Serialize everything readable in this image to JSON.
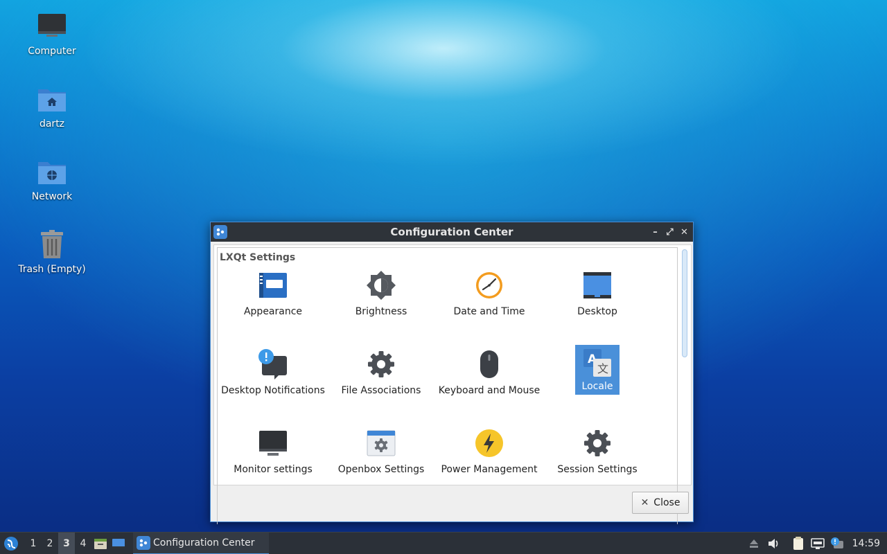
{
  "desktop": {
    "icons": [
      {
        "label": "Computer",
        "icon": "computer-icon"
      },
      {
        "label": "dartz",
        "icon": "home-folder-icon"
      },
      {
        "label": "Network",
        "icon": "network-folder-icon"
      },
      {
        "label": "Trash (Empty)",
        "icon": "trash-icon"
      }
    ]
  },
  "window": {
    "title": "Configuration Center",
    "controls": {
      "minimize": "–",
      "maximize": "⤢",
      "close": "✕"
    },
    "group_title": "LXQt Settings",
    "items": [
      {
        "label": "Appearance",
        "icon": "appearance-icon"
      },
      {
        "label": "Brightness",
        "icon": "brightness-icon"
      },
      {
        "label": "Date and Time",
        "icon": "clock-icon"
      },
      {
        "label": "Desktop",
        "icon": "desktop-icon"
      },
      {
        "label": "Desktop Notifications",
        "icon": "notification-icon"
      },
      {
        "label": "File Associations",
        "icon": "gear-icon"
      },
      {
        "label": "Keyboard and Mouse",
        "icon": "mouse-icon"
      },
      {
        "label": "Locale",
        "icon": "locale-icon",
        "selected": true
      },
      {
        "label": "Monitor settings",
        "icon": "monitor-icon"
      },
      {
        "label": "Openbox Settings",
        "icon": "openbox-icon"
      },
      {
        "label": "Power Management",
        "icon": "power-icon"
      },
      {
        "label": "Session Settings",
        "icon": "gear-icon"
      }
    ],
    "close_button": "Close"
  },
  "taskbar": {
    "workspaces": [
      "1",
      "2",
      "3",
      "4"
    ],
    "active_workspace": "3",
    "task_label": "Configuration Center",
    "clock": "14:59",
    "colors": {
      "accent": "#4a90d9",
      "panel": "#2b3038"
    }
  }
}
